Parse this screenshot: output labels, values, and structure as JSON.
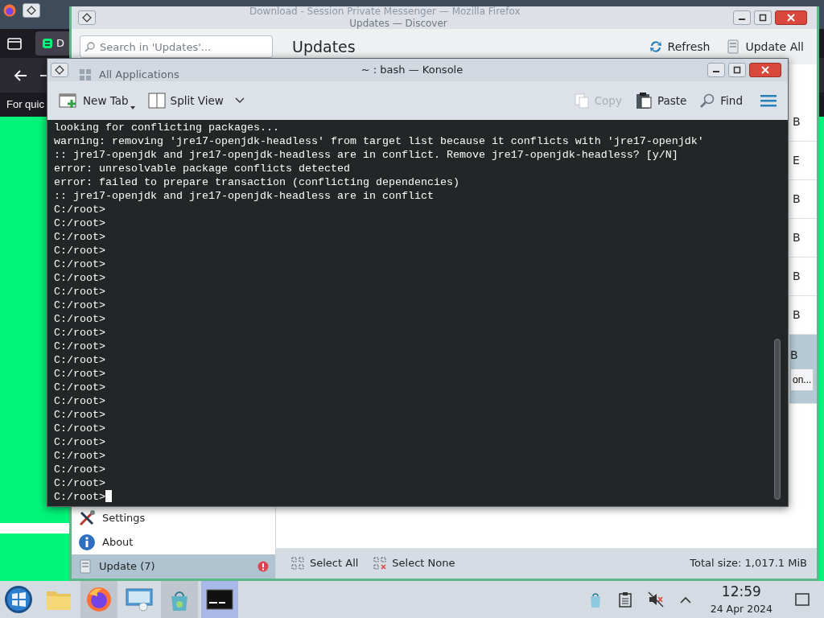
{
  "firefox_window": {
    "title": "Download - Session Private Messenger — Mozilla Firefox",
    "tab_label": "D",
    "page_text": "For quic"
  },
  "discover_window": {
    "title": "Updates — Discover",
    "search": {
      "placeholder": "Search in 'Updates'..."
    },
    "heading": "Updates",
    "actions": [
      {
        "label": "Refresh",
        "kind": "refresh"
      },
      {
        "label": "Update All",
        "kind": "update"
      }
    ],
    "sidebar": {
      "items": [
        {
          "label": "All Applications",
          "kind": "all",
          "selected": false,
          "alert": false
        },
        {
          "label": "Settings",
          "kind": "settings",
          "selected": false,
          "alert": false
        },
        {
          "label": "About",
          "kind": "about",
          "selected": false,
          "alert": false
        },
        {
          "label": "Update (7)",
          "kind": "update",
          "selected": true,
          "alert": true
        }
      ]
    },
    "updates": [
      {
        "size": "B",
        "selected": false
      },
      {
        "size": "E",
        "selected": false
      },
      {
        "size": "B",
        "selected": false
      },
      {
        "size": "B",
        "selected": false
      },
      {
        "size": "B",
        "selected": false
      },
      {
        "size": "B",
        "selected": false
      },
      {
        "size": "B",
        "selected": true,
        "button": "on..."
      }
    ],
    "footer": {
      "actions": [
        {
          "label": "Select All",
          "kind": "select-all"
        },
        {
          "label": "Select None",
          "kind": "select-none"
        }
      ],
      "total": "Total size: 1,017.1 MiB"
    }
  },
  "konsole": {
    "title": "~ : bash — Konsole",
    "toolbar": [
      {
        "label": "New Tab",
        "kind": "new-tab",
        "disabled": false
      },
      {
        "label": "Split View",
        "kind": "split-view",
        "disabled": false
      },
      {
        "label": "Copy",
        "kind": "copy",
        "disabled": true
      },
      {
        "label": "Paste",
        "kind": "paste",
        "disabled": false
      },
      {
        "label": "Find",
        "kind": "find",
        "disabled": false
      }
    ],
    "lines": [
      "looking for conflicting packages...",
      "warning: removing 'jre17-openjdk-headless' from target list because it conflicts with 'jre17-openjdk'",
      ":: jre17-openjdk and jre17-openjdk-headless are in conflict. Remove jre17-openjdk-headless? [y/N]",
      "error: unresolvable package conflicts detected",
      "error: failed to prepare transaction (conflicting dependencies)",
      ":: jre17-openjdk and jre17-openjdk-headless are in conflict",
      "C:/root>",
      "C:/root>",
      "C:/root>",
      "C:/root>",
      "C:/root>",
      "C:/root>",
      "C:/root>",
      "C:/root>",
      "C:/root>",
      "C:/root>",
      "C:/root>",
      "C:/root>",
      "C:/root>",
      "C:/root>",
      "C:/root>",
      "C:/root>",
      "C:/root>",
      "C:/root>",
      "C:/root>",
      "C:/root>",
      "C:/root>",
      "C:/root>"
    ],
    "cursor": true
  },
  "taskbar": {
    "apps": [
      {
        "kind": "folder",
        "active": false,
        "focused": false
      },
      {
        "kind": "firefox",
        "active": true,
        "focused": false
      },
      {
        "kind": "settings",
        "active": false,
        "focused": false
      },
      {
        "kind": "discover",
        "active": true,
        "focused": false
      },
      {
        "kind": "konsole",
        "active": true,
        "focused": true
      }
    ],
    "tray": [
      {
        "kind": "discover"
      },
      {
        "kind": "clipboard"
      },
      {
        "kind": "muted"
      },
      {
        "kind": "expand"
      }
    ],
    "clock": {
      "time": "12:59",
      "date": "24 Apr 2024"
    }
  }
}
